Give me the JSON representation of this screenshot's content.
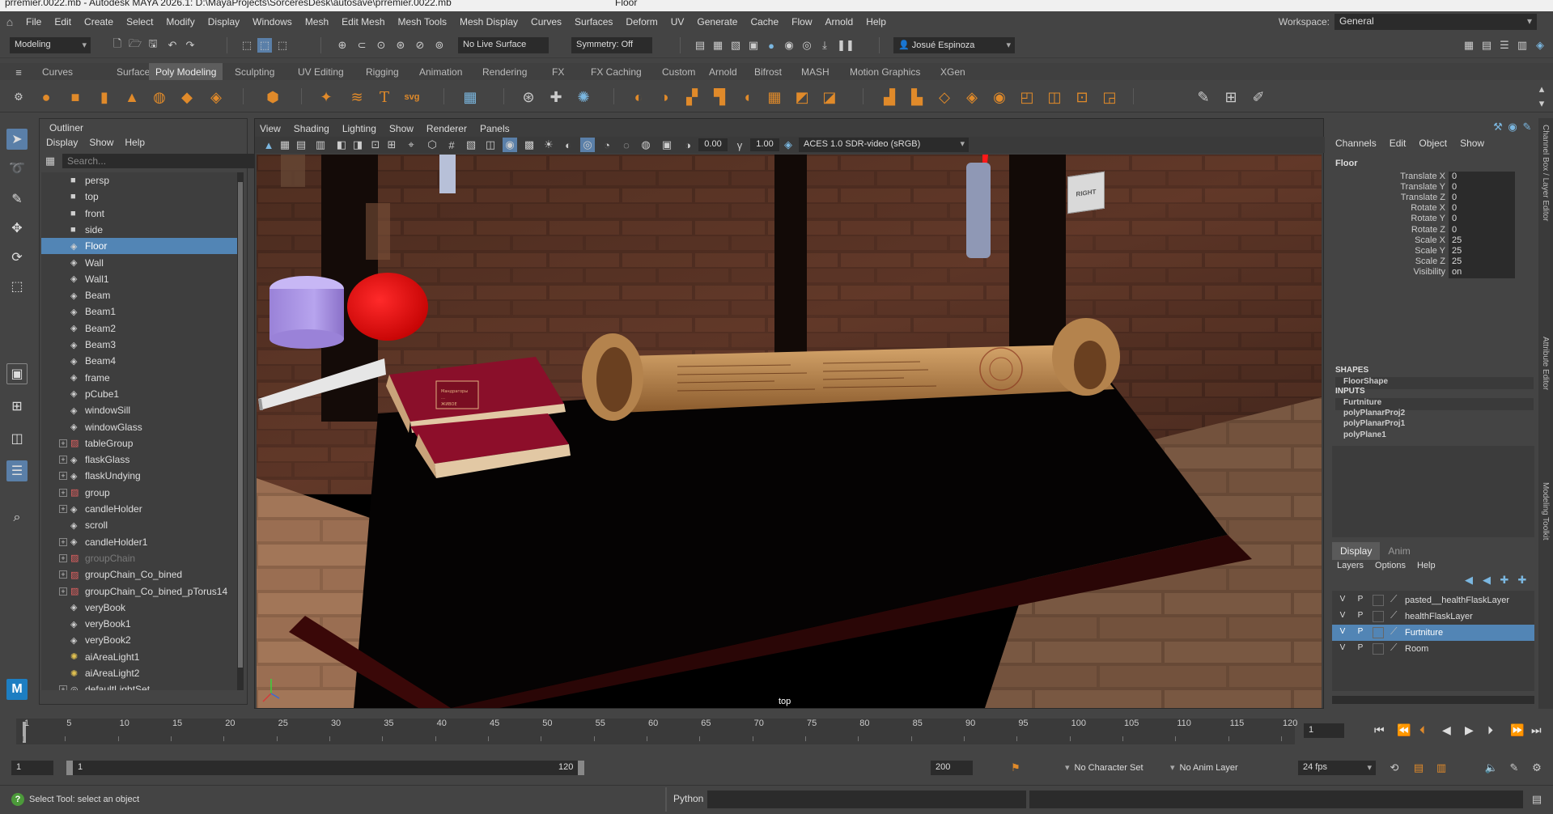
{
  "window": {
    "title": "prremier.0022.mb* - Autodesk MAYA 2026.1: D:\\MayaProjects\\SorceresDesk\\autosave\\prremier.0022.mb  ---  Floor",
    "title_left": "prremier.0022.mb  -  Autodesk MAYA 2026.1: D:\\MayaProjects\\SorceresDesk\\autosave\\prremier.0022.mb",
    "title_right": "Floor"
  },
  "menubar": {
    "items": [
      "File",
      "Edit",
      "Create",
      "Select",
      "Modify",
      "Display",
      "Windows",
      "Mesh",
      "Edit Mesh",
      "Mesh Tools",
      "Mesh Display",
      "Curves",
      "Surfaces",
      "Deform",
      "UV",
      "Generate",
      "Cache",
      "Flow",
      "Arnold",
      "Help"
    ],
    "workspace_label": "Workspace:",
    "workspace_value": "General"
  },
  "statusline": {
    "menuset": "Modeling",
    "live_surface": "No Live Surface",
    "symmetry": "Symmetry: Off",
    "user": "Josué Espinoza"
  },
  "shelf": {
    "tabs": [
      "Curves",
      "Surfaces",
      "Poly Modeling",
      "Sculpting",
      "UV Editing",
      "Rigging",
      "Animation",
      "Rendering",
      "FX",
      "FX Caching",
      "Custom",
      "Arnold",
      "Bifrost",
      "MASH",
      "Motion Graphics",
      "XGen"
    ],
    "active_tab": "Poly Modeling",
    "text_icon": "T",
    "svg_icon": "svg"
  },
  "outliner": {
    "title": "Outliner",
    "menu": [
      "Display",
      "Show",
      "Help"
    ],
    "search_placeholder": "Search...",
    "rows": [
      {
        "label": "persp",
        "icon": "camera-icon",
        "expandable": false,
        "selected": false,
        "dim": false
      },
      {
        "label": "top",
        "icon": "camera-icon",
        "expandable": false,
        "selected": false,
        "dim": false
      },
      {
        "label": "front",
        "icon": "camera-icon",
        "expandable": false,
        "selected": false,
        "dim": false
      },
      {
        "label": "side",
        "icon": "camera-icon",
        "expandable": false,
        "selected": false,
        "dim": false
      },
      {
        "label": "Floor",
        "icon": "mesh-icon",
        "expandable": false,
        "selected": true,
        "dim": false
      },
      {
        "label": "Wall",
        "icon": "mesh-icon",
        "expandable": false,
        "selected": false,
        "dim": false
      },
      {
        "label": "Wall1",
        "icon": "mesh-icon",
        "expandable": false,
        "selected": false,
        "dim": false
      },
      {
        "label": "Beam",
        "icon": "mesh-icon",
        "expandable": false,
        "selected": false,
        "dim": false
      },
      {
        "label": "Beam1",
        "icon": "mesh-icon",
        "expandable": false,
        "selected": false,
        "dim": false
      },
      {
        "label": "Beam2",
        "icon": "mesh-icon",
        "expandable": false,
        "selected": false,
        "dim": false
      },
      {
        "label": "Beam3",
        "icon": "mesh-icon",
        "expandable": false,
        "selected": false,
        "dim": false
      },
      {
        "label": "Beam4",
        "icon": "mesh-icon",
        "expandable": false,
        "selected": false,
        "dim": false
      },
      {
        "label": "frame",
        "icon": "mesh-icon",
        "expandable": false,
        "selected": false,
        "dim": false
      },
      {
        "label": "pCube1",
        "icon": "mesh-icon",
        "expandable": false,
        "selected": false,
        "dim": false
      },
      {
        "label": "windowSill",
        "icon": "mesh-icon",
        "expandable": false,
        "selected": false,
        "dim": false
      },
      {
        "label": "windowGlass",
        "icon": "mesh-icon",
        "expandable": false,
        "selected": false,
        "dim": false
      },
      {
        "label": "tableGroup",
        "icon": "group-icon",
        "expandable": true,
        "selected": false,
        "dim": false
      },
      {
        "label": "flaskGlass",
        "icon": "mesh-icon",
        "expandable": true,
        "selected": false,
        "dim": false
      },
      {
        "label": "flaskUndying",
        "icon": "mesh-icon",
        "expandable": true,
        "selected": false,
        "dim": false
      },
      {
        "label": "group",
        "icon": "group-icon",
        "expandable": true,
        "selected": false,
        "dim": false
      },
      {
        "label": "candleHolder",
        "icon": "mesh-icon",
        "expandable": true,
        "selected": false,
        "dim": false
      },
      {
        "label": "scroll",
        "icon": "mesh-icon",
        "expandable": false,
        "selected": false,
        "dim": false
      },
      {
        "label": "candleHolder1",
        "icon": "mesh-icon",
        "expandable": true,
        "selected": false,
        "dim": false
      },
      {
        "label": "groupChain",
        "icon": "group-icon",
        "expandable": true,
        "selected": false,
        "dim": true
      },
      {
        "label": "groupChain_Co_bined",
        "icon": "group-icon",
        "expandable": true,
        "selected": false,
        "dim": false
      },
      {
        "label": "groupChain_Co_bined_pTorus14",
        "icon": "group-icon",
        "expandable": true,
        "selected": false,
        "dim": false
      },
      {
        "label": "veryBook",
        "icon": "mesh-icon",
        "expandable": false,
        "selected": false,
        "dim": false
      },
      {
        "label": "veryBook1",
        "icon": "mesh-icon",
        "expandable": false,
        "selected": false,
        "dim": false
      },
      {
        "label": "veryBook2",
        "icon": "mesh-icon",
        "expandable": false,
        "selected": false,
        "dim": false
      },
      {
        "label": "aiAreaLight1",
        "icon": "light-icon",
        "expandable": false,
        "selected": false,
        "dim": false
      },
      {
        "label": "aiAreaLight2",
        "icon": "light-icon",
        "expandable": false,
        "selected": false,
        "dim": false
      },
      {
        "label": "defaultLightSet",
        "icon": "set-icon",
        "expandable": true,
        "selected": false,
        "dim": false
      }
    ]
  },
  "viewport": {
    "menu": [
      "View",
      "Shading",
      "Lighting",
      "Show",
      "Renderer",
      "Panels"
    ],
    "exposure": "0.00",
    "gamma": "1.00",
    "color_space": "ACES 1.0 SDR-video (sRGB)",
    "camera_name": "top",
    "viewcube_label": "RIGHT",
    "book_title_lines": [
      "Мандрагоры",
      "…",
      "ЖИВОЕ"
    ]
  },
  "channelbox": {
    "menu": [
      "Channels",
      "Edit",
      "Object",
      "Show"
    ],
    "object": "Floor",
    "attributes": [
      {
        "name": "Translate X",
        "value": "0"
      },
      {
        "name": "Translate Y",
        "value": "0"
      },
      {
        "name": "Translate Z",
        "value": "0"
      },
      {
        "name": "Rotate X",
        "value": "0"
      },
      {
        "name": "Rotate Y",
        "value": "0"
      },
      {
        "name": "Rotate Z",
        "value": "0"
      },
      {
        "name": "Scale X",
        "value": "25"
      },
      {
        "name": "Scale Y",
        "value": "25"
      },
      {
        "name": "Scale Z",
        "value": "25"
      },
      {
        "name": "Visibility",
        "value": "on"
      }
    ],
    "shapes_header": "SHAPES",
    "shapes": [
      "FloorShape"
    ],
    "inputs_header": "INPUTS",
    "inputs": [
      "Furtniture",
      "polyPlanarProj2",
      "polyPlanarProj1",
      "polyPlane1"
    ],
    "side_tabs": [
      "Channel Box / Layer Editor",
      "Attribute Editor",
      "Modeling Toolkit"
    ]
  },
  "layer_editor": {
    "tabs": [
      "Display",
      "Anim"
    ],
    "active_tab": "Display",
    "menu": [
      "Layers",
      "Options",
      "Help"
    ],
    "layers": [
      {
        "v": "V",
        "p": "P",
        "name": "pasted__healthFlaskLayer",
        "selected": false
      },
      {
        "v": "V",
        "p": "P",
        "name": "healthFlaskLayer",
        "selected": false
      },
      {
        "v": "V",
        "p": "P",
        "name": "Furtniture",
        "selected": true
      },
      {
        "v": "V",
        "p": "P",
        "name": "Room",
        "selected": false
      }
    ]
  },
  "timeslider": {
    "ticks": [
      "1",
      "5",
      "10",
      "15",
      "20",
      "25",
      "30",
      "35",
      "40",
      "45",
      "50",
      "55",
      "60",
      "65",
      "70",
      "75",
      "80",
      "85",
      "90",
      "95",
      "100",
      "105",
      "110",
      "115",
      "120"
    ],
    "current_frame": "1"
  },
  "rangeslider": {
    "start": "1",
    "range_start": "1",
    "range_end": "120",
    "end": "200",
    "character_set": "No Character Set",
    "anim_layer": "No Anim Layer",
    "fps": "24 fps"
  },
  "commandline": {
    "help_text": "Select Tool: select an object",
    "language": "Python"
  },
  "colors": {
    "selection": "#5285b5",
    "accent_active_tool": "#5a7fa8",
    "shelf_orange": "#e08a2a",
    "shelf_blue": "#7bb7e0"
  }
}
